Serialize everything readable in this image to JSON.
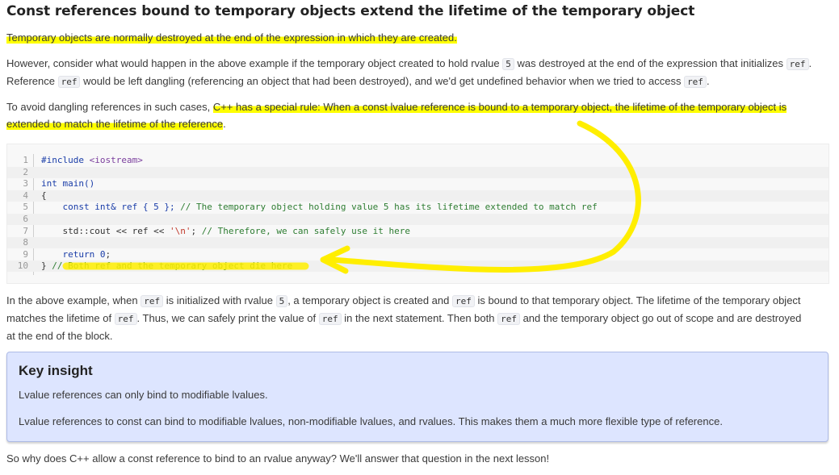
{
  "heading": "Const references bound to temporary objects extend the lifetime of the temporary object",
  "para1": "Temporary objects are normally destroyed at the end of the expression in which they are created.",
  "para2": {
    "a": "However, consider what would happen in the above example if the temporary object created to hold rvalue ",
    "code1": "5",
    "b": " was destroyed at the end of the expression that initializes ",
    "code2": "ref",
    "c": ". Reference ",
    "code3": "ref",
    "d": " would be left dangling (referencing an object that had been destroyed), and we'd get undefined behavior when we tried to access ",
    "code4": "ref",
    "e": "."
  },
  "para3": {
    "a": "To avoid dangling references in such cases, ",
    "highlight1": "C++ has a special rule: When a const lvalue reference is bound to a temporary object, the lifetime of the temporary object is",
    "highlight2": "extended to match the lifetime of the reference",
    "b": "."
  },
  "code_block": {
    "line_numbers": [
      "1",
      "2",
      "3",
      "4",
      "5",
      "6",
      "7",
      "8",
      "9",
      "10"
    ],
    "lines": [
      [
        "#include ",
        "<iostream>"
      ],
      [
        ""
      ],
      [
        "int main()"
      ],
      [
        "{"
      ],
      [
        "    const int& ref { 5 }; ",
        "// The temporary object holding value 5 has its lifetime extended to match ref"
      ],
      [
        ""
      ],
      [
        "    std::cout << ref << ",
        "'\\n'",
        "; ",
        "// Therefore, we can safely use it here"
      ],
      [
        ""
      ],
      [
        "    return ",
        "0",
        ";"
      ],
      [
        "} ",
        "// Both ref and the temporary object die here"
      ]
    ]
  },
  "para4": {
    "a": "In the above example, when ",
    "code1": "ref",
    "b": " is initialized with rvalue ",
    "code2": "5",
    "c": ", a temporary object is created and ",
    "code3": "ref",
    "d": " is bound to that temporary object. The lifetime of the temporary object",
    "e": "matches the lifetime of ",
    "code4": "ref",
    "f": ". Thus, we can safely print the value of ",
    "code5": "ref",
    "g": " in the next statement. Then both ",
    "code6": "ref",
    "h": " and the temporary object go out of scope and are destroyed",
    "i": "at the end of the block."
  },
  "insight": {
    "title": "Key insight",
    "line1": "Lvalue references can only bind to modifiable lvalues.",
    "line2": "Lvalue references to const can bind to modifiable lvalues, non-modifiable lvalues, and rvalues. This makes them a much more flexible type of reference."
  },
  "para5": "So why does C++ allow a const reference to bind to an rvalue anyway? We'll answer that question in the next lesson!",
  "colors": {
    "highlight": "#ffff00",
    "insight_bg": "#dde5ff",
    "annotation": "#ffee00"
  },
  "annotation_icon": "arrow-annotation-icon"
}
